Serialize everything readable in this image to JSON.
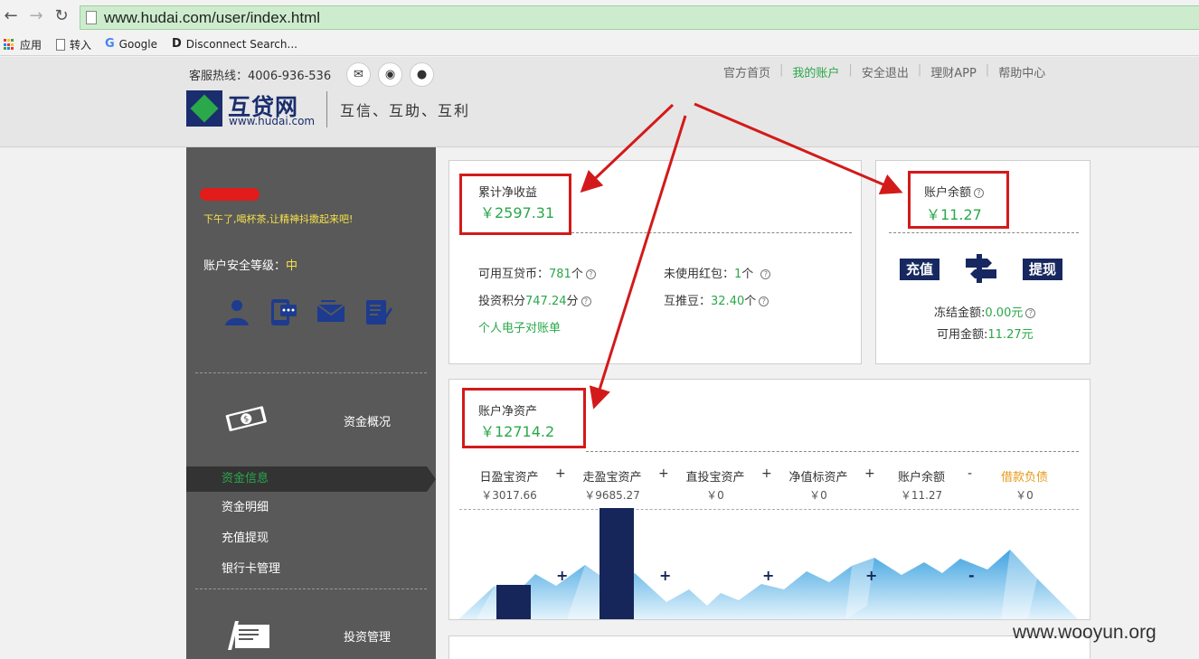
{
  "browser": {
    "url": "www.hudai.com/user/index.html",
    "bookmarks": [
      "应用",
      "转入",
      "Google",
      "Disconnect Search..."
    ]
  },
  "header": {
    "hotline": "客服热线：4006-936-536",
    "logo_text": "互贷网",
    "logo_url": "www.hudai.com",
    "slogan": "互信、互助、互利",
    "nav": [
      "官方首页",
      "我的账户",
      "安全退出",
      "理财APP",
      "帮助中心"
    ],
    "social_icons": [
      "chat-icon",
      "weibo-icon",
      "wechat-icon"
    ]
  },
  "sidebar": {
    "greeting": "下午了,喝杯茶,让精神抖擞起来吧!",
    "security_label": "账户安全等级：",
    "security_level": "中",
    "security_icons": [
      "user-icon",
      "phone-icon",
      "email-icon",
      "id-card-icon"
    ],
    "section_funds": "资金概况",
    "items": [
      "资金信息",
      "资金明细",
      "充值提现",
      "银行卡管理"
    ],
    "section_invest": "投资管理"
  },
  "earnings": {
    "label": "累计净收益",
    "value": "￥2597.31",
    "coins_label": "可用互贷币：",
    "coins_value": "781",
    "coins_unit": "个",
    "redpack_label": "未使用红包：",
    "redpack_value": "1",
    "redpack_unit": "个",
    "points_label": "投资积分",
    "points_value": "747.24",
    "points_unit": "分",
    "beans_label": "互推豆：",
    "beans_value": "32.40",
    "beans_unit": "个",
    "statement_link": "个人电子对账单"
  },
  "balance": {
    "label": "账户余额",
    "value": "￥11.27",
    "recharge": "充值",
    "withdraw": "提现",
    "frozen_label": "冻结金额:",
    "frozen_value": "0.00元",
    "available_label": "可用金额:",
    "available_value": "11.27元"
  },
  "net_assets": {
    "label": "账户净资产",
    "value": "￥12714.2",
    "columns": [
      {
        "name": "日盈宝资产",
        "value": "￥3017.66"
      },
      {
        "name": "走盈宝资产",
        "value": "￥9685.27"
      },
      {
        "name": "直投宝资产",
        "value": "￥0"
      },
      {
        "name": "净值标资产",
        "value": "￥0"
      },
      {
        "name": "账户余额",
        "value": "￥11.27"
      },
      {
        "name": "借款负债",
        "value": "￥0"
      }
    ],
    "operators": [
      "+",
      "+",
      "+",
      "+",
      "-"
    ]
  },
  "chart_data": {
    "type": "bar",
    "categories": [
      "日盈宝资产",
      "走盈宝资产",
      "直投宝资产",
      "净值标资产",
      "账户余额",
      "借款负债"
    ],
    "values": [
      3017.66,
      9685.27,
      0,
      0,
      11.27,
      0
    ],
    "ylim": [
      0,
      9685.27
    ]
  },
  "colors": {
    "accent_green": "#2aa84a",
    "navy": "#16285f",
    "sidebar_bg": "#595959",
    "highlight_red": "#d31a1a",
    "debt_orange": "#e8991a"
  },
  "watermark": "www.wooyun.org"
}
